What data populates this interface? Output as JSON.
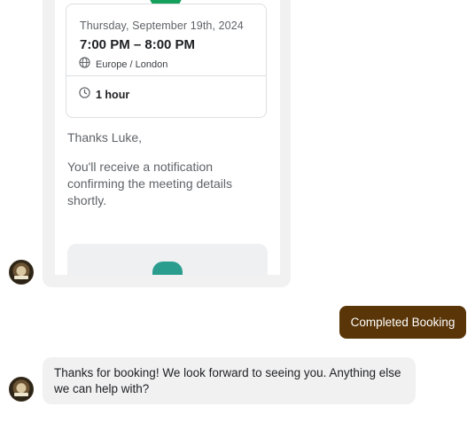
{
  "booking": {
    "date": "Thursday, September 19th, 2024",
    "time": "7:00 PM – 8:00 PM",
    "timezone": "Europe / London",
    "duration": "1 hour",
    "thanks": "Thanks Luke,",
    "notification": "You'll receive a notification confirming the meeting details shortly.",
    "icons": {
      "status": "check-circle-icon",
      "timezone": "globe-icon",
      "duration": "clock-icon",
      "logo": "company-logo-icon"
    },
    "colors": {
      "success": "#15a05b",
      "logo": "#2a9d8f"
    }
  },
  "messages": {
    "user": "Completed Booking",
    "bot": "Thanks for booking! We look forward to seeing you. Anything else we can help with?"
  },
  "colors": {
    "user_bubble": "#5a3508",
    "bot_bubble": "#f1f1f2"
  }
}
